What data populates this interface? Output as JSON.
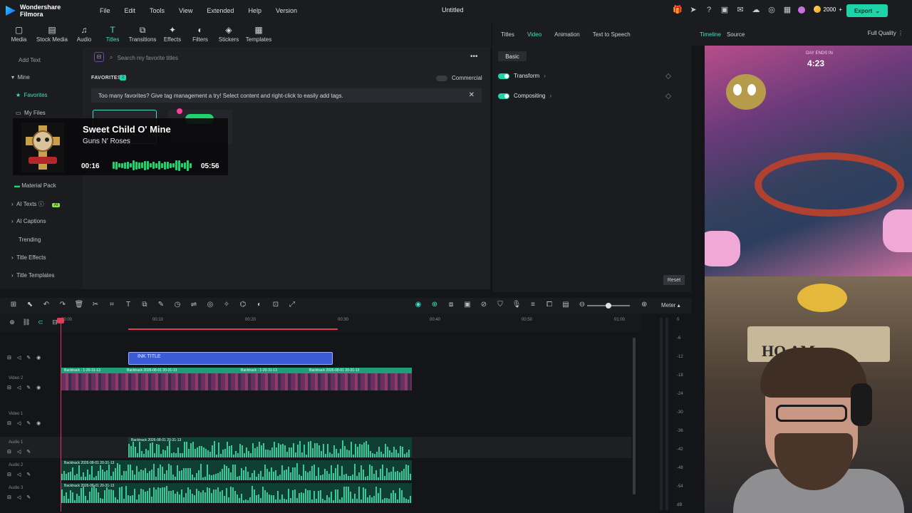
{
  "app": {
    "name": "Wondershare Filmora",
    "title": "Untitled",
    "menu": [
      "File",
      "Edit",
      "Tools",
      "View",
      "Extended",
      "Help",
      "Version"
    ],
    "credits": "2000",
    "export_label": "Export"
  },
  "toolbar": {
    "tabs": [
      {
        "label": "Media",
        "icon": "media-icon"
      },
      {
        "label": "Stock Media",
        "icon": "stock-media-icon"
      },
      {
        "label": "Audio",
        "icon": "music-note-icon"
      },
      {
        "label": "Titles",
        "icon": "text-t-icon",
        "active": true
      },
      {
        "label": "Transitions",
        "icon": "transitions-icon"
      },
      {
        "label": "Effects",
        "icon": "effects-icon"
      },
      {
        "label": "Filters",
        "icon": "filters-icon"
      },
      {
        "label": "Stickers",
        "icon": "stickers-icon"
      },
      {
        "label": "Templates",
        "icon": "templates-icon"
      }
    ]
  },
  "sidebar": {
    "add_text": "Add Text",
    "items": [
      {
        "label": "Mine"
      },
      {
        "label": "Favorites",
        "active": true
      },
      {
        "label": "My Files"
      },
      {
        "label": "Material Pack"
      },
      {
        "label": "AI Texts",
        "badge": "AI"
      },
      {
        "label": "AI Captions"
      },
      {
        "label": "Trending"
      },
      {
        "label": "Title Effects"
      },
      {
        "label": "Title Templates"
      }
    ]
  },
  "panel": {
    "search_placeholder": "Search my favorite titles",
    "favorites_label": "FAVORITES",
    "favorites_count": "2",
    "commercial_label": "Commercial",
    "notice": "Too many favorites? Give tag management a try! Select content and right-click to easily add tags."
  },
  "music_overlay": {
    "song": "Sweet Child O' Mine",
    "artist": "Guns N' Roses",
    "current_time": "00:16",
    "total_time": "05:56",
    "progress": 0.045
  },
  "properties": {
    "tabs": [
      "Titles",
      "Video",
      "Animation",
      "Text to Speech"
    ],
    "active_tab": "Video",
    "basic_tab": "Basic",
    "rows": [
      "Transform",
      "Compositing"
    ],
    "reset_label": "Reset"
  },
  "preview": {
    "tabs": [
      "Timeline",
      "Source"
    ],
    "active_tab": "Timeline",
    "quality": "Full Quality",
    "game_timer": "4:23",
    "game_timer_caption": "DAY ENDS IN",
    "sign_text": "HO  AM"
  },
  "timeline": {
    "meter_label": "Meter",
    "ruler": [
      "00:00",
      "00:10",
      "00:20",
      "00:30",
      "00:40",
      "00:50",
      "01:00"
    ],
    "title_clip_label": "INK TITLE",
    "tracks": [
      "Video 2",
      "Video 1",
      "Audio 1",
      "Audio 2",
      "Audio 3"
    ],
    "video_clip_labels": [
      "Backtrack - 1-20-31-13",
      "Backtrack 2026-08-01 20-31-13",
      "Backtrack - 1-20-31-13",
      "Backtrack 2026-08-01 20-31-13"
    ],
    "audio_clip_label": "Backtrack 2026-08-01 20-31-13",
    "db_scale": [
      "0",
      "-6",
      "-12",
      "-18",
      "-24",
      "-30",
      "-36",
      "-42",
      "-48",
      "-54",
      "dB"
    ]
  },
  "colors": {
    "accent": "#3fe0c5",
    "export": "#1dd3a7",
    "playhead": "#e23b57",
    "title_clip": "#3b5bd6",
    "audio": "#36c99a"
  }
}
